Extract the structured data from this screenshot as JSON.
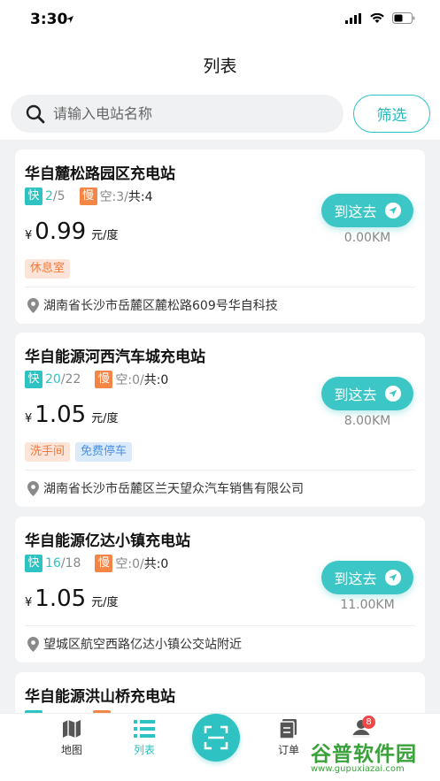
{
  "status_bar": {
    "time": "3:30"
  },
  "header": {
    "title": "列表",
    "search": {
      "placeholder": "请输入电站名称",
      "value": ""
    },
    "filter_label": "筛选"
  },
  "stations": [
    {
      "name": "华自麓松路园区充电站",
      "fast_label": "快",
      "fast_available": "2",
      "fast_sep": "/",
      "fast_total": "5",
      "slow_label": "慢",
      "slow_text": "空:3/",
      "total_text": "共:4",
      "currency": "¥",
      "price": "0.99",
      "unit": "元/度",
      "go_label": "到这去",
      "distance": "0.00KM",
      "tags": [
        "休息室"
      ],
      "address": "湖南省长沙市岳麓区麓松路609号华自科技"
    },
    {
      "name": "华自能源河西汽车城充电站",
      "fast_label": "快",
      "fast_available": "20",
      "fast_sep": "/",
      "fast_total": "22",
      "slow_label": "慢",
      "slow_text": "空:0/",
      "total_text": "共:0",
      "currency": "¥",
      "price": "1.05",
      "unit": "元/度",
      "go_label": "到这去",
      "distance": "8.00KM",
      "tags": [
        "洗手间",
        "免费停车"
      ],
      "address": "湖南省长沙市岳麓区兰天望众汽车销售有限公司"
    },
    {
      "name": "华自能源亿达小镇充电站",
      "fast_label": "快",
      "fast_available": "16",
      "fast_sep": "/",
      "fast_total": "18",
      "slow_label": "慢",
      "slow_text": "空:0/",
      "total_text": "共:0",
      "currency": "¥",
      "price": "1.05",
      "unit": "元/度",
      "go_label": "到这去",
      "distance": "11.00KM",
      "tags": [],
      "address": "望城区航空西路亿达小镇公交站附近"
    },
    {
      "name": "华自能源洪山桥充电站"
    }
  ],
  "tabbar": {
    "map": "地图",
    "list": "列表",
    "orders": "订单",
    "mine_badge": "8"
  },
  "watermark": {
    "title": "谷普软件园",
    "url": "www.gupuxiazai.com"
  },
  "colors": {
    "accent": "#2ec2c3",
    "slow": "#f38545",
    "badge": "#f04848"
  }
}
